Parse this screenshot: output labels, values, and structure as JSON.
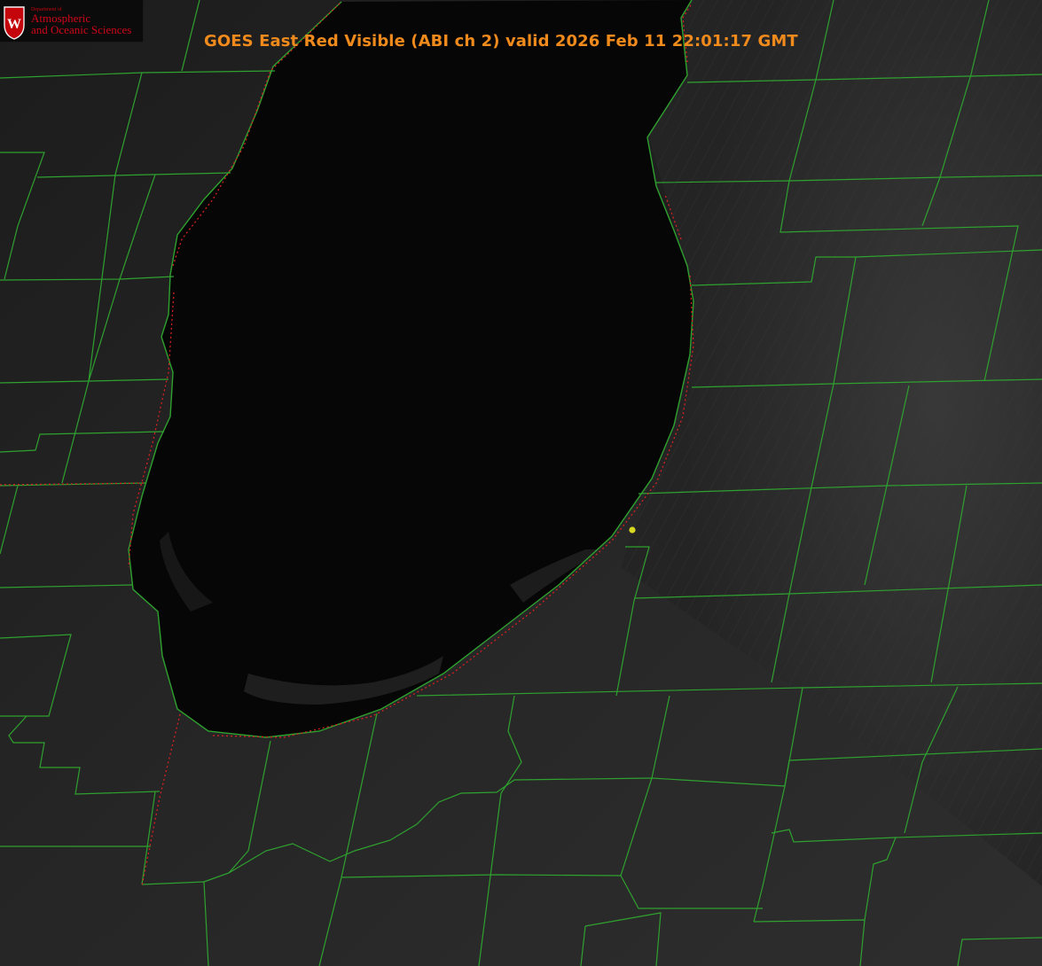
{
  "title": "GOES East Red Visible (ABI ch 2) valid 2026 Feb 11 22:01:17 GMT",
  "logo": {
    "department": "Department of",
    "line1": "Atmospheric",
    "line2": "and Oceanic Sciences",
    "crest_letter": "W"
  },
  "colors": {
    "title": "#f08a1c",
    "county_lines": "#2fa12f",
    "state_line": "#d62020",
    "marker": "#d8d820",
    "logo_red": "#c5050c"
  },
  "map": {
    "product": "visible satellite imagery",
    "layers": [
      "county-boundaries",
      "state-boundaries",
      "lake-shoreline",
      "location-marker"
    ],
    "marker_icon": "yellow-dot-icon"
  }
}
